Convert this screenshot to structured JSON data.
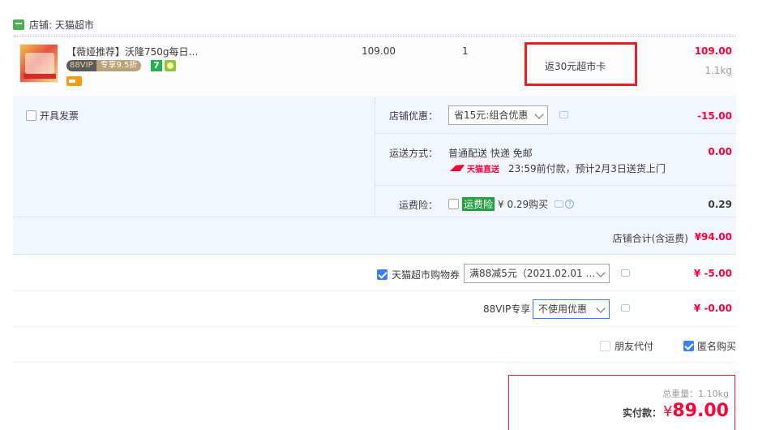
{
  "shop": {
    "name": "店铺: 天猫超市"
  },
  "item": {
    "title": "【薇娅推荐】沃隆750g每日…",
    "vip_left": "88VIP",
    "vip_right": "专享9.5折",
    "tag_seven": "7",
    "unit_price": "109.00",
    "quantity": "1",
    "promo": "返30元超市卡",
    "subtotal": "109.00",
    "weight": "1.1kg"
  },
  "invoice": {
    "label": "开具发票"
  },
  "store_discount": {
    "label": "店铺优惠：",
    "selected": "省15元:组合优惠",
    "amount": "-15.00"
  },
  "shipping": {
    "label": "运送方式：",
    "method": "普通配送 快递 免邮",
    "logo_text": "天猫直送",
    "eta": "23:59前付款，预计2月3日送货上门",
    "amount": "0.00"
  },
  "insurance": {
    "label": "运费险：",
    "tag": "运费险",
    "price": "¥ 0.29购买",
    "q": "?",
    "amount": "0.29"
  },
  "shop_total": {
    "label": "店铺合计(含运费)",
    "amount": "¥94.00"
  },
  "coupon": {
    "label": "天猫超市购物券",
    "selected": "满88减5元（2021.02.01 …",
    "amount": "¥ -5.00"
  },
  "vip": {
    "label": "88VIP专享",
    "selected": "不使用优惠",
    "amount": "¥ -0.00"
  },
  "friend_pay": {
    "label": "朋友代付"
  },
  "anonymous": {
    "label": "匿名购买"
  },
  "summary": {
    "weight_text": "总重量：1.10kg",
    "pay_label": "实付款：",
    "currency": "¥",
    "pay_amount": "89.00"
  }
}
